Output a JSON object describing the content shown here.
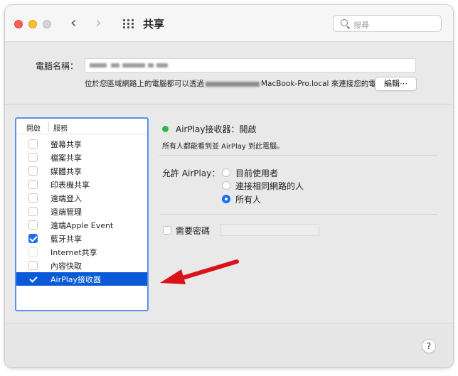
{
  "window": {
    "title": "共享",
    "search_placeholder": "搜尋",
    "back_glyph": "‹",
    "forward_glyph": "›"
  },
  "computer_name": {
    "label": "電腦名稱：",
    "address_prefix": "位於您區域網路上的電腦都可以透過",
    "address_suffix": "MacBook-Pro.local 來連接您的電腦",
    "edit_button": "編輯⋯"
  },
  "service_list": {
    "header_on": "開啟",
    "header_service": "服務",
    "items": [
      {
        "label": "螢幕共享",
        "checked": false,
        "selected": false
      },
      {
        "label": "檔案共享",
        "checked": false,
        "selected": false
      },
      {
        "label": "媒體共享",
        "checked": false,
        "selected": false
      },
      {
        "label": "印表機共享",
        "checked": false,
        "selected": false
      },
      {
        "label": "遠端登入",
        "checked": false,
        "selected": false
      },
      {
        "label": "遠端管理",
        "checked": false,
        "selected": false
      },
      {
        "label": "遠端Apple Event",
        "checked": false,
        "selected": false
      },
      {
        "label": "藍牙共享",
        "checked": true,
        "selected": false
      },
      {
        "label": "Internet共享",
        "checked": false,
        "selected": false
      },
      {
        "label": "內容快取",
        "checked": false,
        "selected": false
      },
      {
        "label": "AirPlay接收器",
        "checked": true,
        "selected": true
      }
    ]
  },
  "detail": {
    "status": "AirPlay接收器：開啟",
    "status_color": "#2cb74a",
    "status_description": "所有人都能看到並 AirPlay 到此電腦。",
    "allow_label": "允許 AirPlay：",
    "radio_options": [
      {
        "label": "目前使用者",
        "selected": false
      },
      {
        "label": "連接相同網路的人",
        "selected": false
      },
      {
        "label": "所有人",
        "selected": true
      }
    ],
    "require_password_label": "需要密碼",
    "require_password_checked": false
  },
  "help_button": "?",
  "accent_color": "#1b6ef3",
  "annotation_arrow_color": "#d8141a"
}
